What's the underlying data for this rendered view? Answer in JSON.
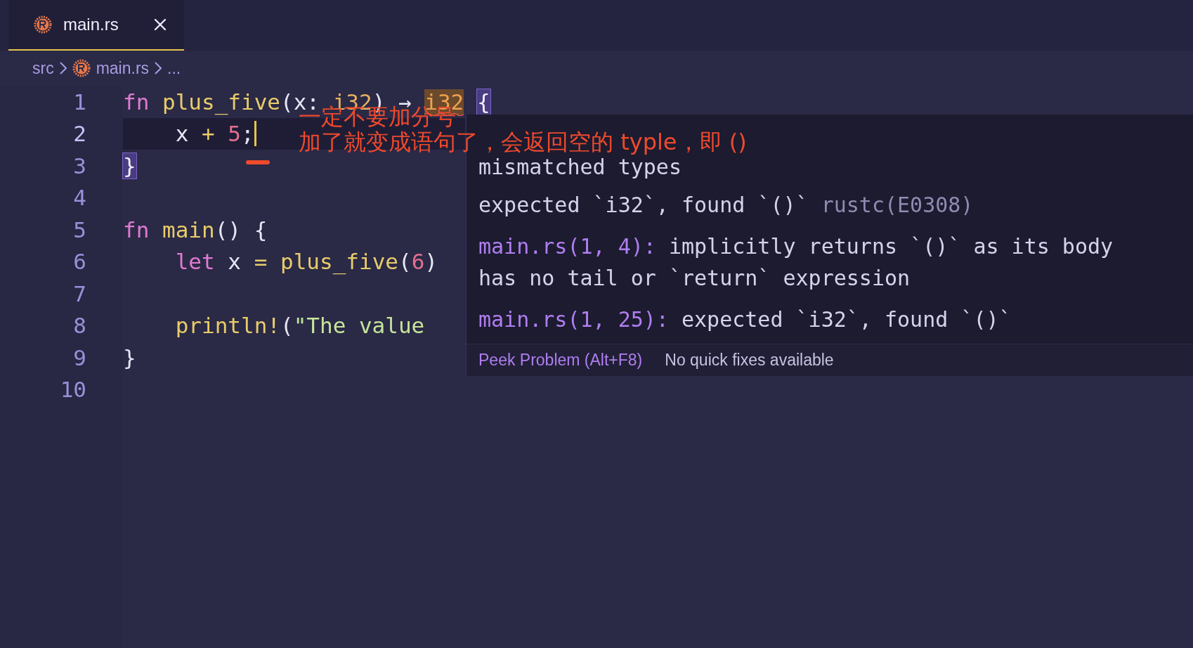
{
  "tab": {
    "label": "main.rs",
    "selected": true
  },
  "breadcrumb": [
    {
      "kind": "folder",
      "label": "src"
    },
    {
      "kind": "file",
      "label": "main.rs"
    },
    {
      "kind": "more",
      "label": "..."
    }
  ],
  "editor": {
    "lines": [
      {
        "number": "1",
        "current": false,
        "tokens": [
          {
            "kind": "keyword",
            "text": "fn"
          },
          {
            "kind": "function",
            "text": " plus_five"
          },
          {
            "kind": "plain",
            "text": "(x: "
          },
          {
            "kind": "type",
            "text": "i32"
          },
          {
            "kind": "plain",
            "text": ") → "
          },
          {
            "kind": "error",
            "text": "i32"
          },
          {
            "kind": "match",
            "text": "{",
            "spaced": true
          }
        ]
      },
      {
        "number": "2",
        "current": true,
        "tokens": [
          {
            "kind": "plain",
            "text": "    x "
          },
          {
            "kind": "operator",
            "text": "+"
          },
          {
            "kind": "number",
            "text": " 5"
          },
          {
            "kind": "plain",
            "text": ";"
          }
        ]
      },
      {
        "number": "3",
        "current": false,
        "tokens": [
          {
            "kind": "match",
            "text": "}"
          }
        ]
      },
      {
        "number": "4",
        "current": false
      },
      {
        "number": "5",
        "current": false,
        "tokens": [
          {
            "kind": "keyword",
            "text": "fn"
          },
          {
            "kind": "function",
            "text": " main"
          },
          {
            "kind": "plain",
            "text": "() {"
          }
        ]
      },
      {
        "number": "6",
        "current": false,
        "tokens": [
          {
            "kind": "keyword",
            "text": "    let"
          },
          {
            "kind": "plain",
            "text": " x "
          },
          {
            "kind": "operator",
            "text": "="
          },
          {
            "kind": "function",
            "text": " plus_five"
          },
          {
            "kind": "plain",
            "text": "("
          },
          {
            "kind": "number",
            "text": "6"
          },
          {
            "kind": "plain",
            "text": ")"
          }
        ]
      },
      {
        "number": "7",
        "current": false
      },
      {
        "number": "8",
        "current": false,
        "tokens": [
          {
            "kind": "function",
            "text": "    println!"
          },
          {
            "kind": "plain",
            "text": "("
          },
          {
            "kind": "string",
            "text": "\"The value"
          }
        ]
      },
      {
        "number": "9",
        "current": false,
        "tokens": [
          {
            "kind": "plain",
            "text": "}"
          }
        ]
      },
      {
        "number": "10",
        "current": false
      }
    ]
  },
  "hover": {
    "title": "mismatched types",
    "messages": [
      {
        "text": "expected `i32`, found `()`",
        "code": "rustc(E0308)"
      },
      {
        "source": "main.rs(1, 4):",
        "text": "implicitly returns `()` as its body",
        "continuation": "has no tail or `return` expression"
      },
      {
        "source": "main.rs(1, 25):",
        "text": "expected `i32`, found `()`"
      }
    ],
    "link": "Peek Problem (Alt+F8)",
    "note": "No quick fixes available"
  },
  "annotation": {
    "lines": [
      "一定不要加分号",
      "加了就变成语句了，会返回空的 typle，即 ()"
    ]
  }
}
